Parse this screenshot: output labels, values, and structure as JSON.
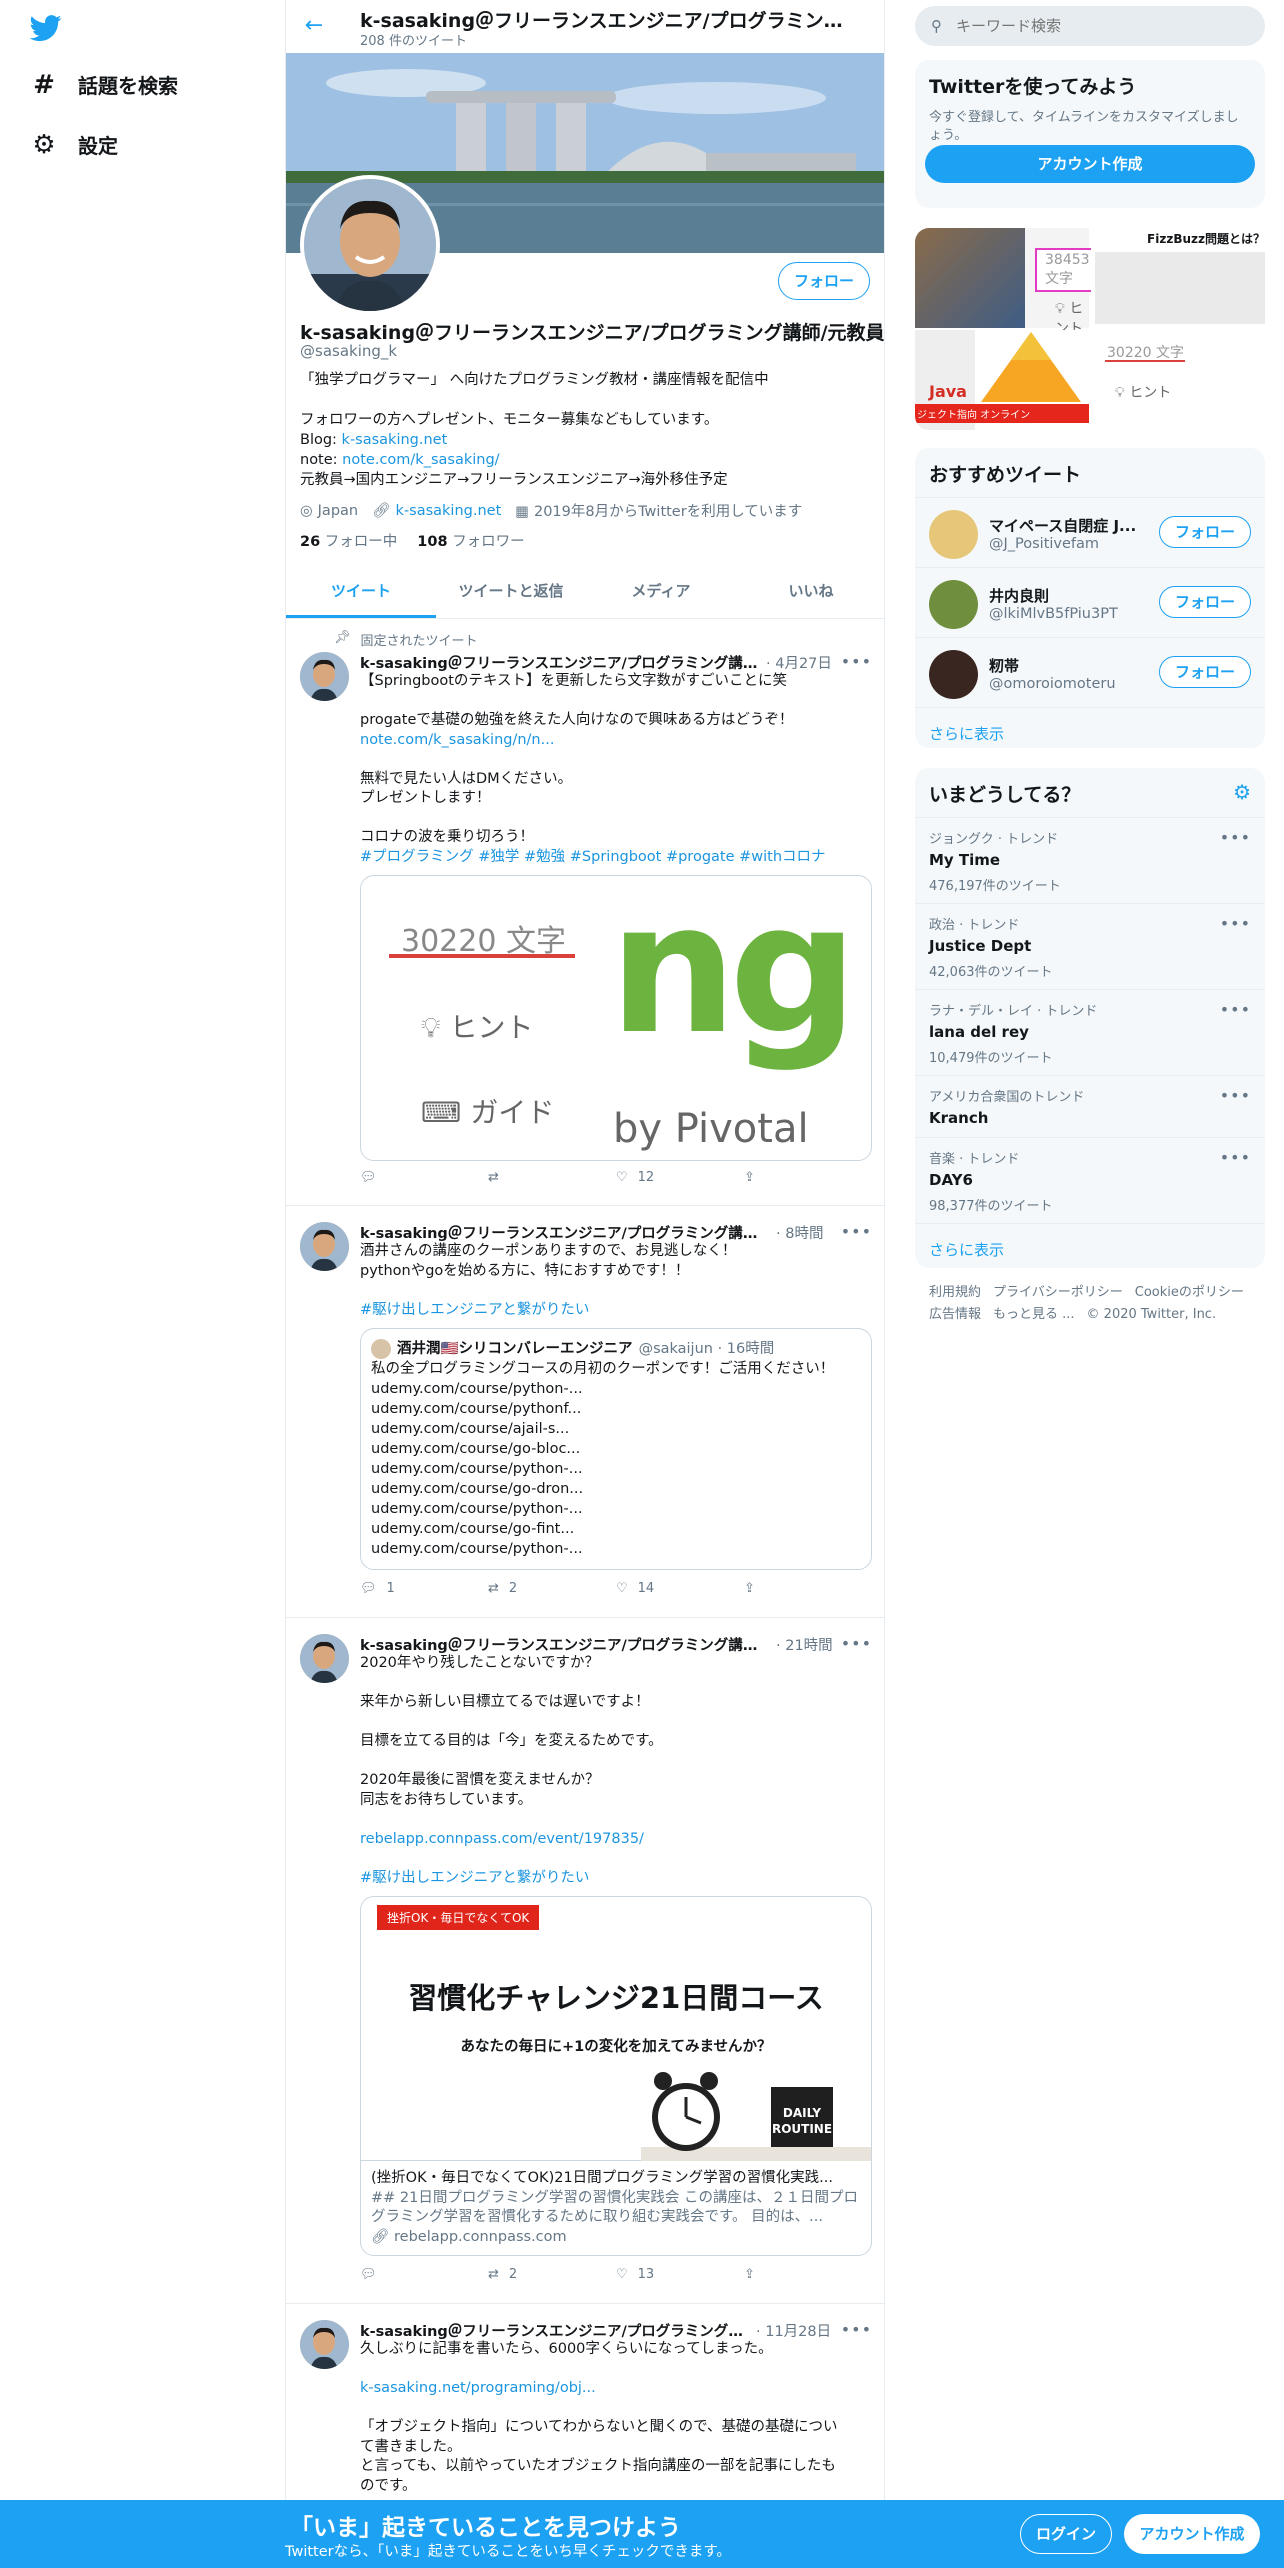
{
  "nav": {
    "explore": "話題を検索",
    "settings": "設定"
  },
  "header": {
    "title": "k-sasaking＠フリーランスエンジニア/プログラミング講師/元教員",
    "tweet_count": "208 件のツイート"
  },
  "profile": {
    "follow_label": "フォロー",
    "name": "k-sasaking＠フリーランスエンジニア/プログラミング講師/元教員",
    "handle": "@sasaking_k",
    "bio": [
      "「独学プログラマー」 へ向けたプログラミング教材・講座情報を配信中",
      "",
      "フォロワーの方へプレゼント、モニター募集などもしています。"
    ],
    "blog_label": "Blog: ",
    "blog_link": "k-sasaking.net",
    "note_label": "note: ",
    "note_link": "note.com/k_sasaking/",
    "career": "元教員→国内エンジニア→フリーランスエンジニア→海外移住予定",
    "location": "Japan",
    "website": "k-sasaking.net",
    "joined": "2019年8月からTwitterを利用しています",
    "following_count": "26",
    "following_label": "フォロー中",
    "followers_count": "108",
    "followers_label": "フォロワー"
  },
  "tabs": [
    "ツイート",
    "ツイートと返信",
    "メディア",
    "いいね"
  ],
  "tweets": [
    {
      "pinned": "固定されたツイート",
      "name": "k-sasaking＠フリーランスエンジニア/プログラミング講師/元教員",
      "time": "· 4月27日",
      "lines": [
        "【Springbootのテキスト】を更新したら文字数がすごいことに笑",
        "",
        "progateで基礎の勉強を終えた人向けなので興味ある方はどうぞ！",
        "note.com/k_sasaking/n/n...",
        "",
        "無料で見たい人はDMください。",
        "プレゼントします！",
        "",
        "コロナの波を乗り切ろう！",
        "#プログラミング #独学 #勉強 #Springboot #progate #withコロナ"
      ],
      "image": {
        "count": "30220 文字",
        "hint": "ヒント",
        "guide": "ガイド",
        "logo": "ng",
        "by": "by Pivotal"
      },
      "reply": "",
      "retweet": "",
      "like": "12"
    },
    {
      "name": "k-sasaking＠フリーランスエンジニア/プログラミング講師/元教員",
      "time": "· 8時間",
      "lines": [
        "酒井さんの講座のクーポンありますので、お見逃しなく！",
        "pythonやgoを始める方に、特におすすめです！！",
        "",
        "#駆け出しエンジニアと繋がりたい"
      ],
      "quote": {
        "name": "酒井潤🇺🇸シリコンバレーエンジニア",
        "handle": "@sakaijun · 16時間",
        "lines": [
          "私の全プログラミングコースの月初のクーポンです！ご活用ください！",
          "udemy.com/course/python-...",
          "udemy.com/course/pythonf...",
          "udemy.com/course/ajail-s...",
          "udemy.com/course/go-bloc...",
          "udemy.com/course/python-...",
          "udemy.com/course/go-dron...",
          "udemy.com/course/python-...",
          "udemy.com/course/go-fint...",
          "udemy.com/course/python-..."
        ]
      },
      "reply": "1",
      "retweet": "2",
      "like": "14"
    },
    {
      "name": "k-sasaking＠フリーランスエンジニア/プログラミング講師/元教員",
      "time": "· 21時間",
      "lines": [
        "2020年やり残したことないですか？",
        "",
        "来年から新しい目標立てるでは遅いですよ！",
        "",
        "目標を立てる目的は「今」を変えるためです。",
        "",
        "2020年最後に習慣を変えませんか？",
        "同志をお待ちしています。",
        "",
        "rebelapp.connpass.com/event/197835/",
        "",
        "#駆け出しエンジニアと繋がりたい"
      ],
      "card": {
        "badge": "挫折OK・毎日でなくてOK",
        "headline": "習慣化チャレンジ21日間コース",
        "sub": "あなたの毎日に+1の変化を加えてみませんか？",
        "daily1": "DAILY",
        "daily2": "ROUTINE",
        "title": "(挫折OK・毎日でなくてOK)21日間プログラミング学習の習慣化実践...",
        "desc": "## 21日間プログラミング学習の習慣化実践会 この講座は、２１日間プログラミング学習を習慣化するために取り組む実践会です。 目的は、...",
        "domain": "rebelapp.connpass.com"
      },
      "reply": "",
      "retweet": "2",
      "like": "13"
    },
    {
      "name": "k-sasaking＠フリーランスエンジニア/プログラミング講師/元教員",
      "time": "· 11月28日",
      "lines": [
        "久しぶりに記事を書いたら、6000字くらいになってしまった。",
        "",
        "k-sasaking.net/programing/obj...",
        "",
        "「オブジェクト指向」についてわからないと聞くので、基礎の基礎につい",
        "て書きました。",
        "と言っても、以前やっていたオブジェクト指向講座の一部を記事にしたも",
        "のです。"
      ]
    }
  ],
  "sidebar": {
    "search_placeholder": "キーワード検索",
    "signup": {
      "title": "Twitterを使ってみよう",
      "desc": "今すぐ登録して、タイムラインをカスタマイズしましょう。",
      "button": "アカウント作成"
    },
    "media": {
      "count1": "38453 文字",
      "hint": "ヒント",
      "fizz": "FizzBuzz問題とは？",
      "count2": "30220 文字",
      "hint2": "ヒント",
      "java": "Java",
      "oop": "ジェクト指向 オンライン"
    },
    "recommend": {
      "title": "おすすめツイート",
      "users": [
        {
          "name": "マイペース自閉症 J...",
          "handle": "@J_Positivefam"
        },
        {
          "name": "井内良則",
          "handle": "@lkiMlvB5fPiu3PT"
        },
        {
          "name": "籾帯",
          "handle": "@omoroiomoteru"
        }
      ],
      "follow": "フォロー",
      "more": "さらに表示"
    },
    "trends": {
      "title": "いまどうしてる？",
      "items": [
        {
          "ctx": "ジョングク · トレンド",
          "name": "My Time",
          "count": "476,197件のツイート"
        },
        {
          "ctx": "政治 · トレンド",
          "name": "Justice Dept",
          "count": "42,063件のツイート"
        },
        {
          "ctx": "ラナ・デル・レイ · トレンド",
          "name": "lana del rey",
          "count": "10,479件のツイート"
        },
        {
          "ctx": "アメリカ合衆国のトレンド",
          "name": "Kranch",
          "count": ""
        },
        {
          "ctx": "音楽 · トレンド",
          "name": "DAY6",
          "count": "98,377件のツイート"
        }
      ],
      "more": "さらに表示"
    },
    "footer": {
      "l1": [
        "利用規約",
        "プライバシーポリシー",
        "Cookieのポリシー"
      ],
      "l2": [
        "広告情報",
        "もっと見る ...",
        "© 2020 Twitter, Inc."
      ]
    }
  },
  "bottom": {
    "title": "「いま」起きていることを見つけよう",
    "sub": "Twitterなら、「いま」起きていることをいち早くチェックできます。",
    "login": "ログイン",
    "signup": "アカウント作成"
  },
  "colors": {
    "accent": "#1da1f2",
    "link": "#1b95e0",
    "secondary": "#657786"
  }
}
